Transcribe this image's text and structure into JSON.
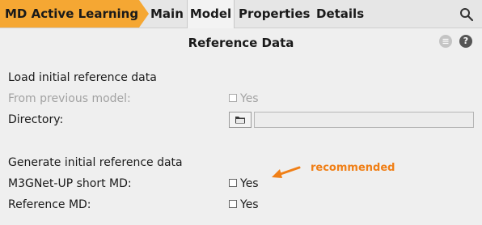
{
  "header": {
    "breadcrumb": "MD Active Learning",
    "tabs": [
      {
        "label": "Main",
        "active": false
      },
      {
        "label": "Model",
        "active": true
      },
      {
        "label": "Properties",
        "active": false
      },
      {
        "label": "Details",
        "active": false
      }
    ],
    "search_icon": "search-icon"
  },
  "panel": {
    "title": "Reference Data",
    "menu_icon": "menu-icon",
    "help_label": "?"
  },
  "load": {
    "heading": "Load initial reference data",
    "from_previous_label": "From previous model:",
    "from_previous_option": "Yes",
    "from_previous_enabled": false,
    "directory_label": "Directory:",
    "directory_value": "",
    "folder_icon": "folder-icon"
  },
  "generate": {
    "heading": "Generate initial reference data",
    "m3gnet_label": "M3GNet-UP short MD:",
    "m3gnet_option": "Yes",
    "reference_label": "Reference MD:",
    "reference_option": "Yes"
  },
  "annotation": {
    "text": "recommended",
    "color": "#f07f16"
  },
  "colors": {
    "accent": "#f5a733",
    "annotation": "#f07f16"
  }
}
